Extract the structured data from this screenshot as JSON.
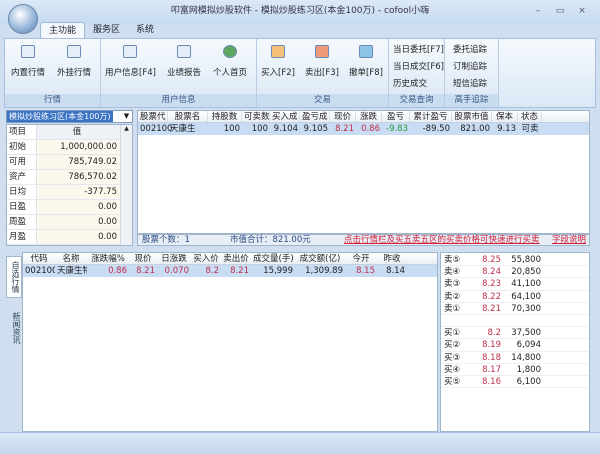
{
  "window": {
    "title": "叩富网模拟炒股软件 - 模拟炒股练习区(本金100万) - cofool小嗨",
    "minimize": "–",
    "maximize": "▭",
    "close": "×"
  },
  "tabs": [
    "主功能",
    "服务区",
    "系统"
  ],
  "ribbon": {
    "market": {
      "label": "行情",
      "buttons": [
        "内置行情",
        "外挂行情"
      ]
    },
    "user": {
      "label": "用户信息",
      "buttons": [
        "用户信息[F4]",
        "业绩报告",
        "个人首页"
      ]
    },
    "trade": {
      "label": "交易",
      "buttons": [
        "买入[F2]",
        "卖出[F3]",
        "撤单[F8]"
      ]
    },
    "query": {
      "label": "交易查询",
      "links": [
        "当日委托[F7]",
        "当日成交[F6]",
        "历史成交"
      ]
    },
    "track": {
      "label": "高手追踪",
      "links": [
        "委托追踪",
        "订制追踪",
        "短信追踪"
      ]
    }
  },
  "account": {
    "selected": "模拟炒股练习区(本金100万)",
    "header": [
      "项目",
      "值"
    ],
    "rows": [
      [
        "初始",
        "1,000,000.00"
      ],
      [
        "可用",
        "785,749.02"
      ],
      [
        "资产",
        "786,570.02"
      ],
      [
        "日均",
        "-377.75"
      ],
      [
        "日盈",
        "0.00"
      ],
      [
        "周盈",
        "0.00"
      ],
      [
        "月盈",
        "0.00"
      ]
    ]
  },
  "positions": {
    "columns": [
      "股票代",
      "股票名",
      "持股数",
      "可卖数",
      "买入成",
      "盈亏成",
      "现价",
      "涨跌",
      "盈亏",
      "累计盈亏",
      "股票市值",
      "保本",
      "状态"
    ],
    "rows": [
      [
        "002100",
        "天康生",
        "100",
        "100",
        "9.104",
        "9.105",
        "8.21",
        "0.86",
        "-9.83",
        "-89.50",
        "821.00",
        "9.13",
        "可卖"
      ]
    ],
    "count_text": "股票个数：1",
    "total_text": "市值合计：821.00元",
    "hint": "点击行情栏及买五卖五区的买卖价格可快速进行买卖",
    "help_link": "字段说明"
  },
  "side_tabs": [
    "自选行情",
    "新闻资讯"
  ],
  "quotes": {
    "columns": [
      "代码",
      "名称",
      "涨跌幅%",
      "现价",
      "日涨跌",
      "买入价",
      "卖出价",
      "成交量(手)",
      "成交额(亿)",
      "今开",
      "昨收"
    ],
    "rows": [
      [
        "002100",
        "天康生物",
        "0.86",
        "8.21",
        "0.070",
        "8.2",
        "8.21",
        "15,999",
        "1,309.89",
        "8.15",
        "8.14"
      ]
    ]
  },
  "order_book": {
    "asks": [
      [
        "卖⑤",
        "8.25",
        "55,800"
      ],
      [
        "卖④",
        "8.24",
        "20,850"
      ],
      [
        "卖③",
        "8.23",
        "41,100"
      ],
      [
        "卖②",
        "8.22",
        "64,100"
      ],
      [
        "卖①",
        "8.21",
        "70,300"
      ]
    ],
    "bids": [
      [
        "买①",
        "8.2",
        "37,500"
      ],
      [
        "买②",
        "8.19",
        "6,094"
      ],
      [
        "买③",
        "8.18",
        "14,800"
      ],
      [
        "买④",
        "8.17",
        "1,800"
      ],
      [
        "买⑤",
        "8.16",
        "6,100"
      ]
    ]
  }
}
